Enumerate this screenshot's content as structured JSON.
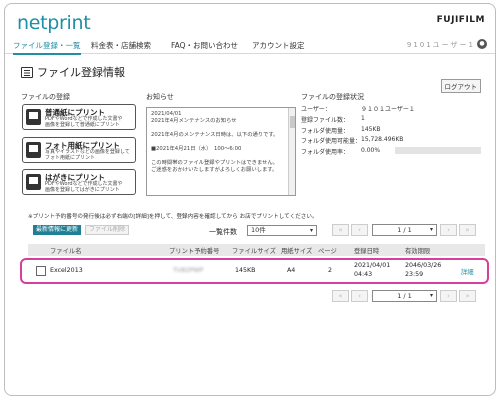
{
  "app": {
    "logo": "netprint",
    "brand": "FUJIFILM"
  },
  "nav": {
    "tabs": [
      {
        "label": "ファイル登録・一覧",
        "active": true
      },
      {
        "label": "料金表・店舗検索",
        "active": false
      },
      {
        "label": "FAQ・お問い合わせ",
        "active": false
      },
      {
        "label": "アカウント設定",
        "active": false
      }
    ],
    "user_id": "9101ユーザー1"
  },
  "page": {
    "title": "ファイル登録情報",
    "logout_label": "ログアウト"
  },
  "register": {
    "heading": "ファイルの登録",
    "buttons": [
      {
        "title": "普通紙にプリント",
        "desc1": "PDFやWordなどで作成した文書や",
        "desc2": "画像を登録して普通紙にプリント",
        "icon": "document-icon"
      },
      {
        "title": "フォト用紙にプリント",
        "desc1": "写真やイラストなどの画像を登録して",
        "desc2": "フォト用紙にプリント",
        "icon": "photo-icon"
      },
      {
        "title": "はがきにプリント",
        "desc1": "PDFやWordなどで作成した文書や",
        "desc2": "画像を登録してはがきにプリント",
        "icon": "postcard-icon"
      }
    ]
  },
  "notice": {
    "heading": "お知らせ",
    "lines": [
      "2021/04/01",
      "2021年4月メンテナンスのお知らせ",
      "",
      "2021年4月のメンテナンス日時は、以下の通りです。",
      "",
      "■2021年4月21日（水）　100〜6:00",
      "",
      "この時間帯のファイル登録やプリントはできません。",
      "ご迷惑をおかけいたしますがよろしくお願いします。"
    ]
  },
  "status": {
    "heading": "ファイルの登録状況",
    "rows": [
      {
        "label": "ユーザー：",
        "value": "９１０１ユーザー１"
      },
      {
        "label": "登録ファイル数：",
        "value": "1"
      },
      {
        "label": "フォルダ使用量：",
        "value": "145KB"
      },
      {
        "label": "フォルダ使用可能量：",
        "value": "15,728.496KB"
      },
      {
        "label": "フォルダ使用率：",
        "value": "0.00%"
      }
    ],
    "usage_fraction": 0.0
  },
  "list": {
    "note": "※プリント予約番号の発行後は必ず右端の[詳細]を押して、登録内容を確認してから お店でプリントしてください。",
    "refresh_label": "最新情報に更新",
    "delete_label": "ファイル削除",
    "count_label": "一覧件数",
    "count_value": "10件",
    "page_value": "1 / 1",
    "columns": [
      "ファイル名",
      "プリント予約番号",
      "ファイルサイズ",
      "用紙サイズ",
      "ページ",
      "登録日時",
      "有効期限"
    ],
    "rows": [
      {
        "file_name": "Excel2013",
        "reservation": "TU82PWP",
        "size": "145KB",
        "paper": "A4",
        "pages": "2",
        "registered_date": "2021/04/01",
        "registered_time": "04:43",
        "expires_date": "2046/03/26",
        "expires_time": "23:59",
        "detail_label": "詳細"
      }
    ]
  },
  "colors": {
    "accent": "#1e8fa5",
    "highlight": "#d63f9e",
    "refresh_button": "#1e7f95"
  }
}
